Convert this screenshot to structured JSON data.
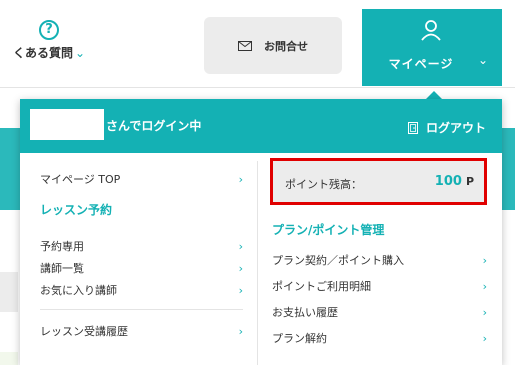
{
  "header": {
    "faq_label": "くある質問",
    "faq_chevron": "⌄",
    "contact_label": "お問合せ",
    "mypage_label": "マイページ",
    "mypage_chevron": "⌄"
  },
  "dropdown": {
    "login_status": "さんでログイン中",
    "logout_label": "ログアウト",
    "left": {
      "mypage_top": "マイページ TOP",
      "lesson_section": "レッスン予約",
      "lesson_items": [
        "予約専用",
        "講師一覧",
        "お気に入り講師"
      ],
      "history": "レッスン受講履歴"
    },
    "balance": {
      "label": "ポイント残高：",
      "value": "100",
      "unit": "P"
    },
    "right": {
      "plan_section": "プラン/ポイント管理",
      "plan_items": [
        "プラン契約／ポイント購入",
        "ポイントご利用明細",
        "お支払い履歴",
        "プラン解約"
      ]
    }
  },
  "chevron": "›",
  "colors": {
    "accent": "#14b1b4",
    "highlight": "#e00000",
    "panel_bg": "#ececec"
  },
  "icons": [
    "help-circle-icon",
    "mail-icon",
    "person-icon",
    "logout-door-icon",
    "chevron-right-icon"
  ]
}
